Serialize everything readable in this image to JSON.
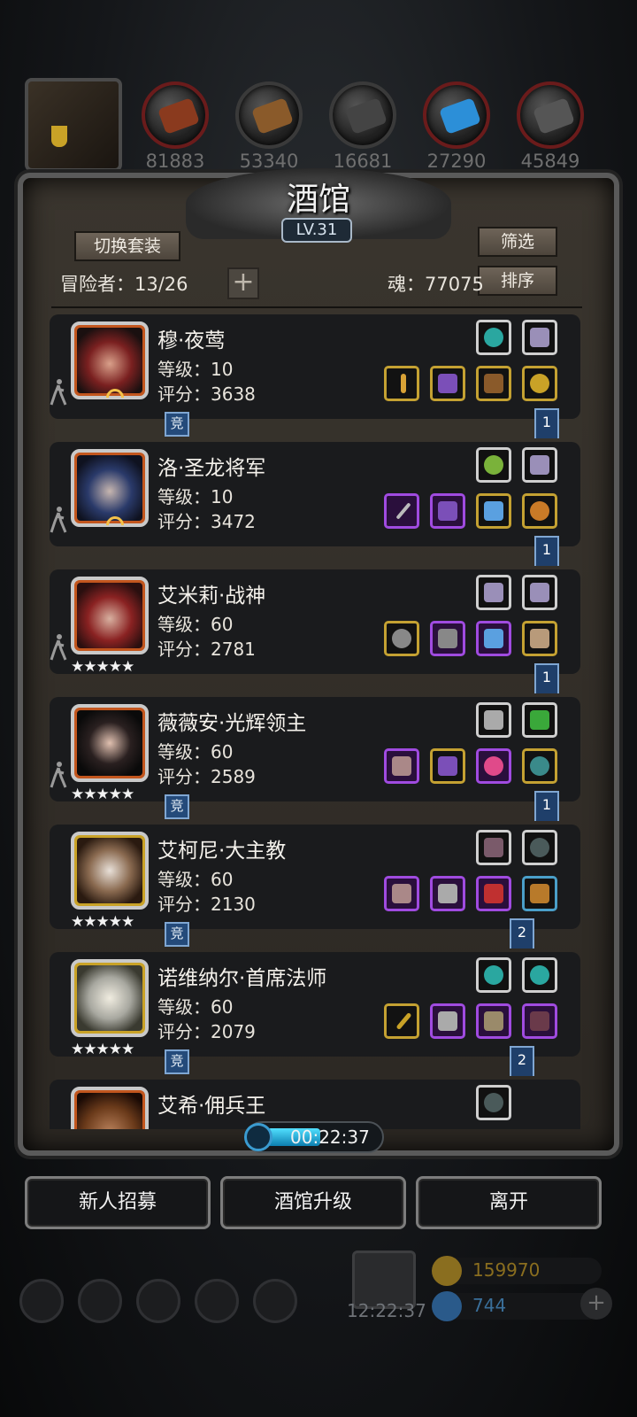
{
  "resources": [
    {
      "name": "wood-red",
      "value": "81883"
    },
    {
      "name": "plank",
      "value": "53340"
    },
    {
      "name": "iron",
      "value": "16681"
    },
    {
      "name": "crystal",
      "value": "27290"
    },
    {
      "name": "steel",
      "value": "45849"
    }
  ],
  "tavern": {
    "title": "酒馆",
    "level": "LV.31",
    "switch_set_label": "切换套装",
    "filter_label": "筛选",
    "sort_label": "排序",
    "adventurer_label": "冒险者：13/26",
    "plus": "+",
    "soul_label": "魂：77075"
  },
  "heroes": [
    {
      "name": "穆·夜莺",
      "level": "等级：10",
      "score": "评分：3638",
      "tag": "竞",
      "flag": "1"
    },
    {
      "name": "洛·圣龙将军",
      "level": "等级：10",
      "score": "评分：3472",
      "tag": "",
      "flag": "1"
    },
    {
      "name": "艾米莉·战神",
      "level": "等级：60",
      "score": "评分：2781",
      "stars": "★★★★★",
      "tag": "",
      "flag": "1"
    },
    {
      "name": "薇薇安·光辉领主",
      "level": "等级：60",
      "score": "评分：2589",
      "stars": "★★★★★",
      "tag": "竞",
      "flag": "1"
    },
    {
      "name": "艾柯尼·大主教",
      "level": "等级：60",
      "score": "评分：2130",
      "stars": "★★★★★",
      "tag": "竞",
      "flag": "2"
    },
    {
      "name": "诺维纳尔·首席法师",
      "level": "等级：60",
      "score": "评分：2079",
      "stars": "★★★★★",
      "tag": "竞",
      "flag": "2"
    },
    {
      "name": "艾希·佣兵王"
    }
  ],
  "timer": "00:22:37",
  "buttons": {
    "recruit": "新人招募",
    "upgrade": "酒馆升级",
    "leave": "离开"
  },
  "hud": {
    "clock": "12:22:37",
    "gold": "159970",
    "gems": "744",
    "plus": "+"
  },
  "colors": {
    "gold_text": "#8a6e1f",
    "gem_text": "#3a6f9a"
  }
}
